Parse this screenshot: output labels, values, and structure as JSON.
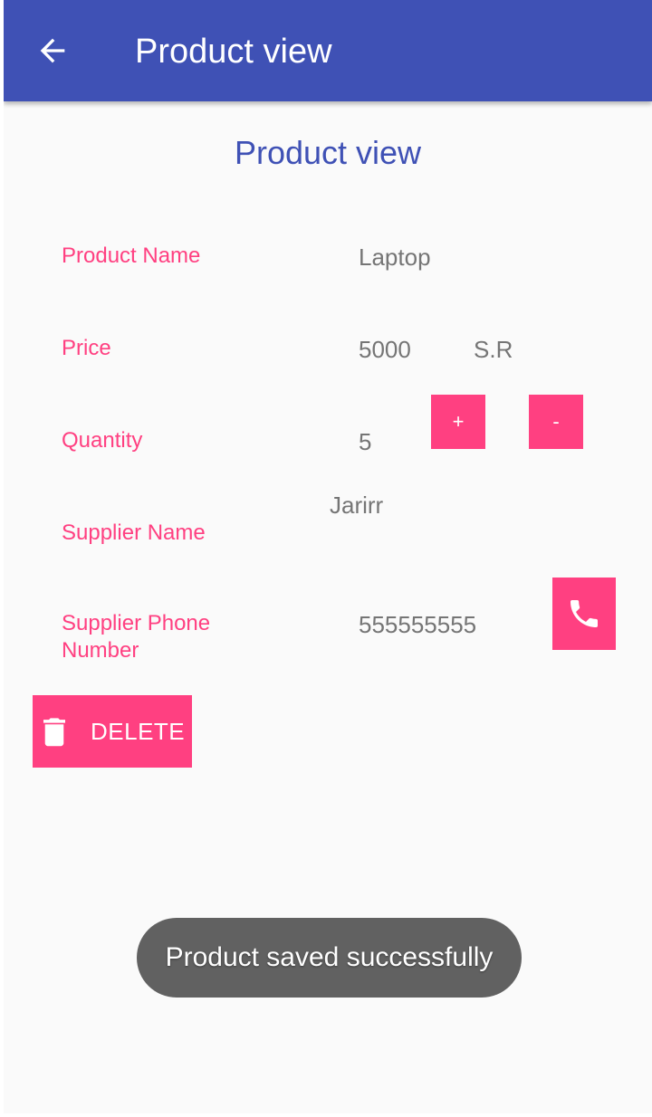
{
  "app_bar": {
    "back_icon": "arrow-back-icon",
    "title": "Product view",
    "color": "#3f51b5"
  },
  "page": {
    "heading": "Product view"
  },
  "fields": {
    "product_name": {
      "label": "Product Name",
      "value": "Laptop"
    },
    "price": {
      "label": "Price",
      "value": "5000",
      "currency": "S.R"
    },
    "quantity": {
      "label": "Quantity",
      "value": "5",
      "increment_label": "+",
      "decrement_label": "-"
    },
    "supplier_name": {
      "label": "Supplier Name",
      "value": "Jarirr"
    },
    "supplier_phone": {
      "label_line1": "Supplier Phone",
      "label_line2": "Number",
      "value": "555555555",
      "call_icon": "phone-icon"
    }
  },
  "delete_button": {
    "label": "DELETE",
    "icon": "trash-icon"
  },
  "toast": {
    "message": "Product saved successfully"
  },
  "colors": {
    "accent": "#ff4081",
    "primary": "#3f51b5",
    "value_text": "#757575"
  }
}
